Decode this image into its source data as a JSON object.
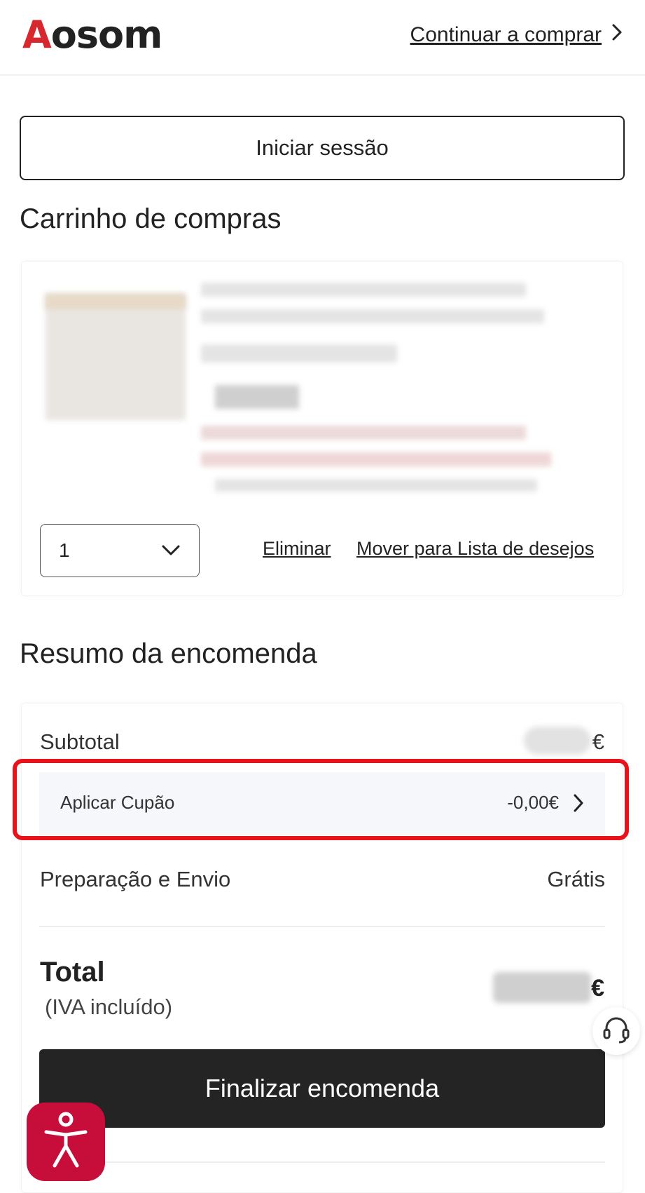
{
  "header": {
    "logo_a": "A",
    "logo_rest": "osom",
    "continue_label": "Continuar a comprar",
    "brand_color": "#d7282f"
  },
  "login_label": "Iniciar sessão",
  "cart": {
    "title": "Carrinho de compras",
    "quantity": "1",
    "remove_label": "Eliminar",
    "wishlist_label": "Mover para Lista de desejos"
  },
  "summary": {
    "title": "Resumo da encomenda",
    "subtotal_label": "Subtotal",
    "subtotal_currency": "€",
    "coupon_label": "Aplicar Cupão",
    "coupon_value": "-0,00€",
    "shipping_label": "Preparação e Envio",
    "shipping_value": "Grátis",
    "total_label": "Total",
    "vat_note": "(IVA incluído)",
    "total_currency": "€",
    "checkout_label": "Finalizar encomenda"
  },
  "colors": {
    "highlight": "#e8121b",
    "checkout_bg": "#242424",
    "accessibility_bg": "#c70d3a"
  },
  "icons": {
    "continue": "chevron-right-icon",
    "quantity": "chevron-down-icon",
    "coupon": "chevron-right-icon",
    "support": "headset-icon",
    "accessibility": "accessibility-person-icon"
  }
}
